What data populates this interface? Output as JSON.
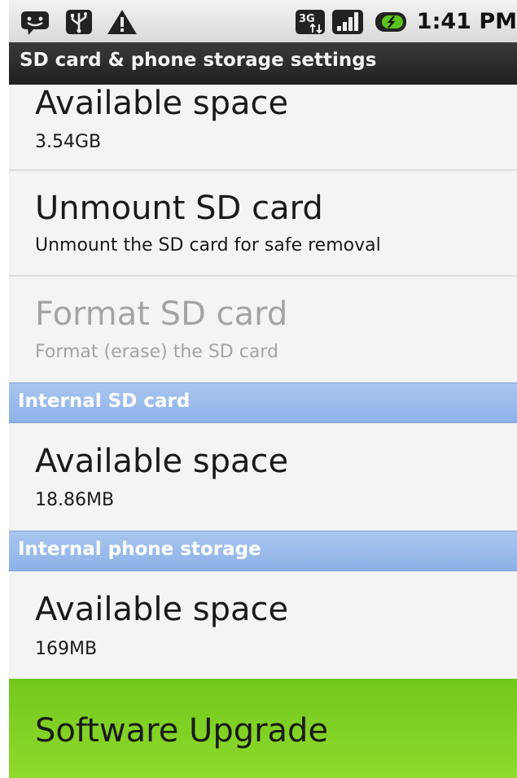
{
  "status_bar": {
    "time": "1:41 PM",
    "icons": [
      "chat-notification-icon",
      "usb-icon",
      "warning-icon",
      "3g-data-icon",
      "signal-icon",
      "battery-icon"
    ]
  },
  "title_bar": {
    "title": "SD card & phone storage settings"
  },
  "sd_card": {
    "available_space": {
      "title": "Available space",
      "summary": "3.54GB"
    },
    "unmount": {
      "title": "Unmount SD card",
      "summary": "Unmount the SD card for safe removal"
    },
    "format": {
      "title": "Format SD card",
      "summary": "Format (erase) the SD card"
    }
  },
  "internal_sd_card": {
    "header": "Internal SD card",
    "available_space": {
      "title": "Available space",
      "summary": "18.86MB"
    }
  },
  "internal_phone_storage": {
    "header": "Internal phone storage",
    "available_space": {
      "title": "Available space",
      "summary": "169MB"
    }
  },
  "software_upgrade": {
    "label": "Software Upgrade"
  },
  "colors": {
    "category_background": "#98bbec",
    "upgrade_background": "#80d024",
    "title_bar_background": "#2a2a2a",
    "disabled_text": "#a4a4a4"
  }
}
